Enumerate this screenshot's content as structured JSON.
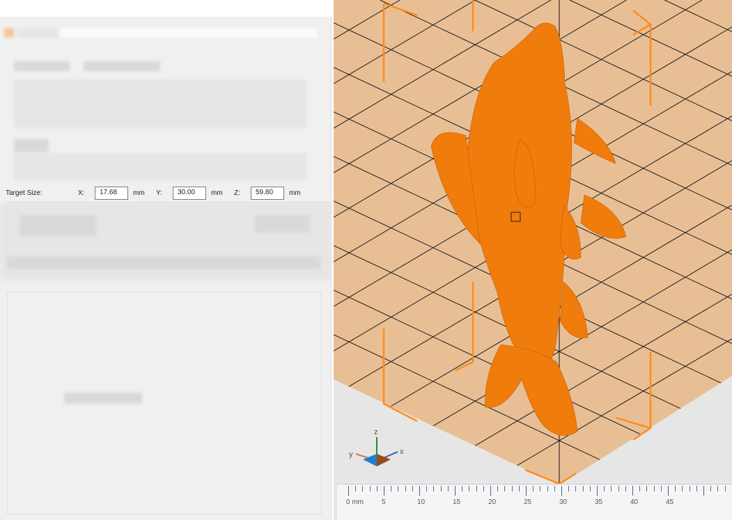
{
  "target_size": {
    "label": "Target Size:",
    "x_label": "X:",
    "x_value": "17.68",
    "y_label": "Y:",
    "y_value": "30.00",
    "z_label": "Z:",
    "z_value": "59.80",
    "unit": "mm"
  },
  "gizmo": {
    "z": "z",
    "y": "y",
    "x": "x"
  },
  "ruler": {
    "labels": [
      "0 mm",
      "5",
      "10",
      "15",
      "20",
      "25",
      "30",
      "35",
      "40",
      "45"
    ]
  },
  "colors": {
    "bed": "#e8bf95",
    "model": "#f07c0c",
    "frame": "#ff8c1a"
  }
}
